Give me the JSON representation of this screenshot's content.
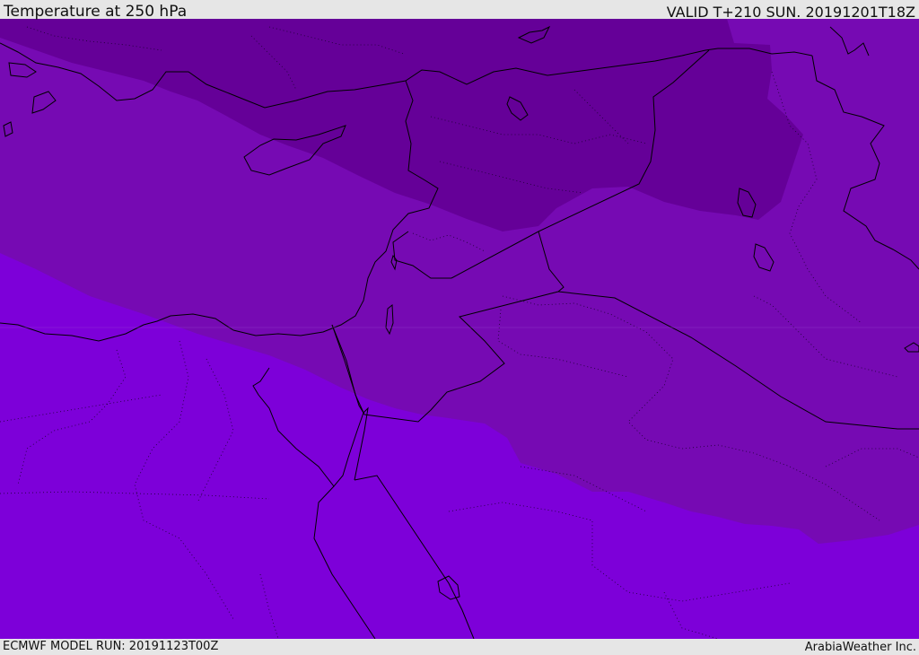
{
  "header": {
    "title": "Temperature at 250 hPa",
    "valid_time": "VALID T+210 SUN. 20191201T18Z"
  },
  "footer": {
    "model_run": "ECMWF MODEL RUN: 20191123T00Z",
    "credit": "ArabiaWeather Inc."
  },
  "map": {
    "field": "temperature",
    "pressure_level": "250 hPa",
    "shading_colors": {
      "coldest": "#650098",
      "middle": "#760ab3",
      "warmest": "#7d00d9"
    },
    "border_color": "#000000"
  }
}
